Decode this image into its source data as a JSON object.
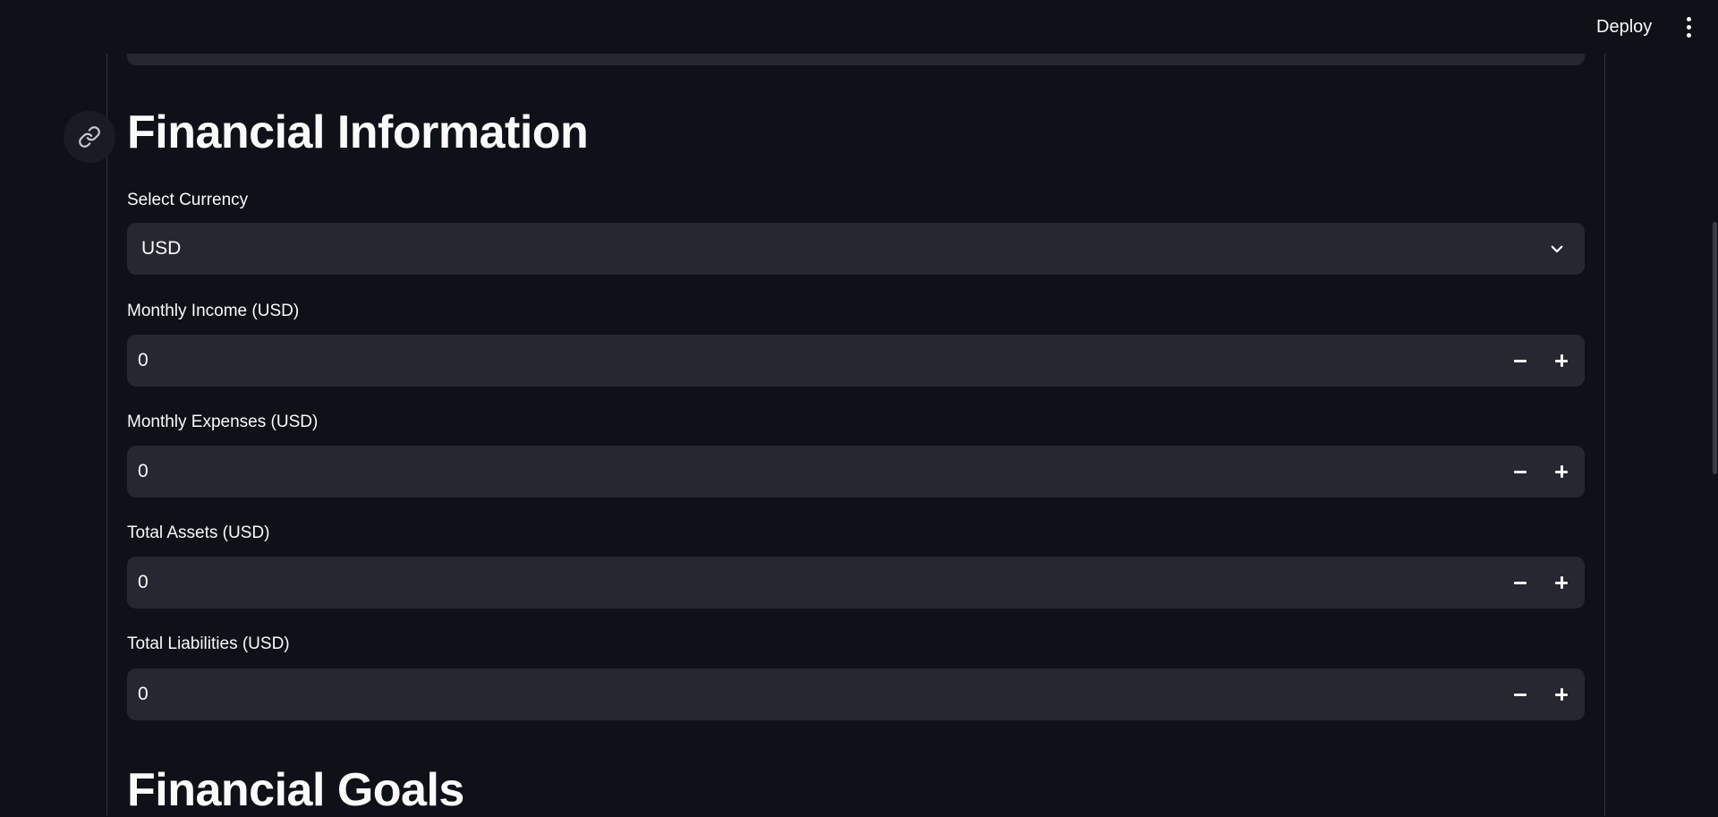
{
  "header": {
    "deploy_label": "Deploy",
    "menu_icon": "kebab-menu-icon"
  },
  "section_financial_info": {
    "title": "Financial Information",
    "anchor_icon": "link-icon"
  },
  "currency": {
    "label": "Select Currency",
    "selected": "USD",
    "dropdown_icon": "chevron-down-icon"
  },
  "fields": [
    {
      "label": "Monthly Income (USD)",
      "value": "0"
    },
    {
      "label": "Monthly Expenses (USD)",
      "value": "0"
    },
    {
      "label": "Total Assets (USD)",
      "value": "0"
    },
    {
      "label": "Total Liabilities (USD)",
      "value": "0"
    }
  ],
  "section_financial_goals": {
    "title": "Financial Goals"
  },
  "colors": {
    "background": "#0e1117",
    "input_bg": "#262730",
    "text": "#fafafa",
    "divider": "#31333f"
  }
}
